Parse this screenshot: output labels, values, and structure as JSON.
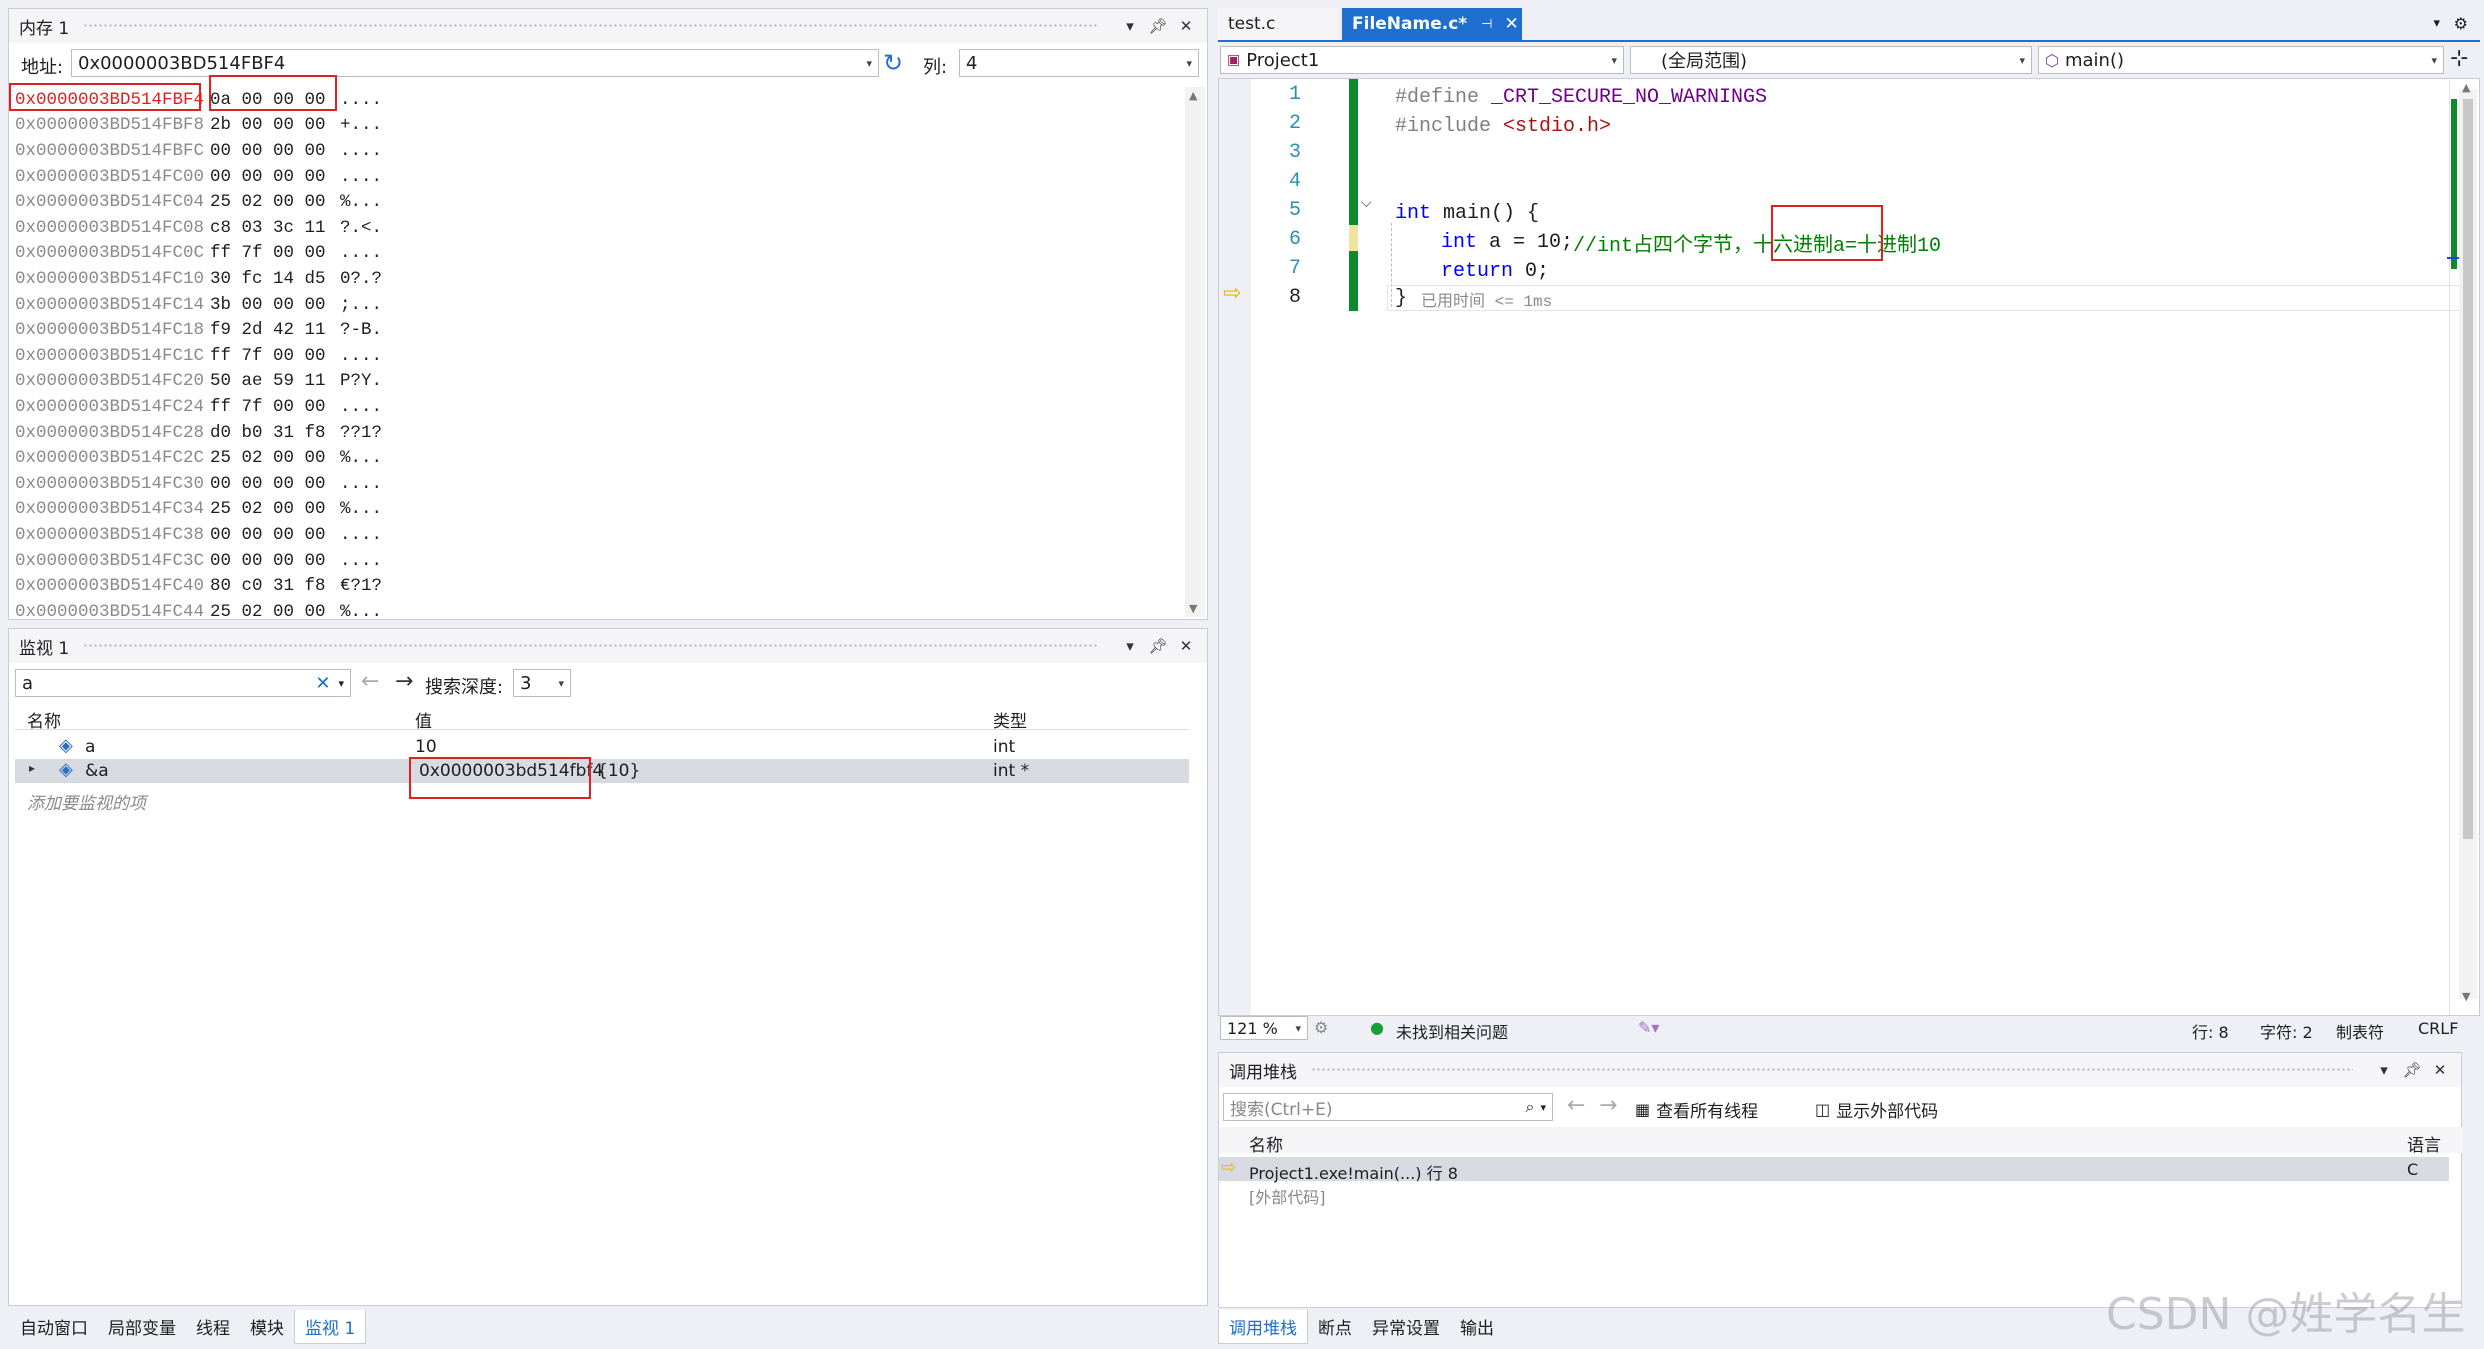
{
  "memory": {
    "title": "内存 1",
    "address_label": "地址:",
    "address_value": "0x0000003BD514FBF4",
    "columns_label": "列:",
    "columns_value": "4",
    "rows": [
      {
        "addr": "0x0000003BD514FBF4",
        "bytes": "0a 00 00 00",
        "ascii": "...."
      },
      {
        "addr": "0x0000003BD514FBF8",
        "bytes": "2b 00 00 00",
        "ascii": "+..."
      },
      {
        "addr": "0x0000003BD514FBFC",
        "bytes": "00 00 00 00",
        "ascii": "...."
      },
      {
        "addr": "0x0000003BD514FC00",
        "bytes": "00 00 00 00",
        "ascii": "...."
      },
      {
        "addr": "0x0000003BD514FC04",
        "bytes": "25 02 00 00",
        "ascii": "%..."
      },
      {
        "addr": "0x0000003BD514FC08",
        "bytes": "c8 03 3c 11",
        "ascii": "?.<."
      },
      {
        "addr": "0x0000003BD514FC0C",
        "bytes": "ff 7f 00 00",
        "ascii": "...."
      },
      {
        "addr": "0x0000003BD514FC10",
        "bytes": "30 fc 14 d5",
        "ascii": "0?.?"
      },
      {
        "addr": "0x0000003BD514FC14",
        "bytes": "3b 00 00 00",
        "ascii": ";..."
      },
      {
        "addr": "0x0000003BD514FC18",
        "bytes": "f9 2d 42 11",
        "ascii": "?-B."
      },
      {
        "addr": "0x0000003BD514FC1C",
        "bytes": "ff 7f 00 00",
        "ascii": "...."
      },
      {
        "addr": "0x0000003BD514FC20",
        "bytes": "50 ae 59 11",
        "ascii": "P?Y."
      },
      {
        "addr": "0x0000003BD514FC24",
        "bytes": "ff 7f 00 00",
        "ascii": "...."
      },
      {
        "addr": "0x0000003BD514FC28",
        "bytes": "d0 b0 31 f8",
        "ascii": "??1?"
      },
      {
        "addr": "0x0000003BD514FC2C",
        "bytes": "25 02 00 00",
        "ascii": "%..."
      },
      {
        "addr": "0x0000003BD514FC30",
        "bytes": "00 00 00 00",
        "ascii": "...."
      },
      {
        "addr": "0x0000003BD514FC34",
        "bytes": "25 02 00 00",
        "ascii": "%..."
      },
      {
        "addr": "0x0000003BD514FC38",
        "bytes": "00 00 00 00",
        "ascii": "...."
      },
      {
        "addr": "0x0000003BD514FC3C",
        "bytes": "00 00 00 00",
        "ascii": "...."
      },
      {
        "addr": "0x0000003BD514FC40",
        "bytes": "80 c0 31 f8",
        "ascii": "€?1?"
      },
      {
        "addr": "0x0000003BD514FC44",
        "bytes": "25 02 00 00",
        "ascii": "%..."
      }
    ]
  },
  "watch": {
    "title": "监视 1",
    "search_value": "a",
    "search_depth_label": "搜索深度:",
    "search_depth_value": "3",
    "col_name": "名称",
    "col_value": "值",
    "col_type": "类型",
    "rows": [
      {
        "name": "a",
        "value": "10",
        "type": "int"
      },
      {
        "name": "&a",
        "value": "0x0000003bd514fbf4",
        "value_suffix": "{10}",
        "type": "int *"
      }
    ],
    "add_hint": "添加要监视的项"
  },
  "bottom_tabs_left": [
    "自动窗口",
    "局部变量",
    "线程",
    "模块",
    "监视 1"
  ],
  "editor": {
    "tabs": [
      {
        "label": "test.c",
        "active": false
      },
      {
        "label": "FileName.c*",
        "active": true
      }
    ],
    "project": "Project1",
    "scope": "(全局范围)",
    "function": "main()",
    "line_numbers": [
      "1",
      "2",
      "3",
      "4",
      "5",
      "6",
      "7",
      "8"
    ],
    "lines": {
      "l1_pre": "#define ",
      "l1_macro": "_CRT_SECURE_NO_WARNINGS",
      "l2_pre": "#include ",
      "l2_str": "<stdio.h>",
      "l5_kw": "int",
      "l5_rest": " main() {",
      "l6_kw": "int",
      "l6_rest": " a = 10;",
      "l6_comment": "//int占四个字节，十六进制a=十进制10",
      "l7_kw": "return",
      "l7_rest": " 0;",
      "l8_brace": "}",
      "l8_hint": "已用时间 <= 1ms"
    },
    "zoom": "121 %",
    "issues": "未找到相关问题",
    "line_status": "行: 8",
    "char_status": "字符: 2",
    "tab_status": "制表符",
    "eol_status": "CRLF"
  },
  "callstack": {
    "title": "调用堆栈",
    "search_placeholder": "搜索(Ctrl+E)",
    "view_threads": "查看所有线程",
    "show_external": "显示外部代码",
    "col_name": "名称",
    "col_lang": "语言",
    "rows": [
      {
        "name": "Project1.exe!main(...) 行 8",
        "lang": "C"
      },
      {
        "name": "[外部代码]",
        "lang": ""
      }
    ]
  },
  "bottom_tabs_right": [
    "调用堆栈",
    "断点",
    "异常设置",
    "输出"
  ],
  "watermark": "CSDN @姓学名生"
}
